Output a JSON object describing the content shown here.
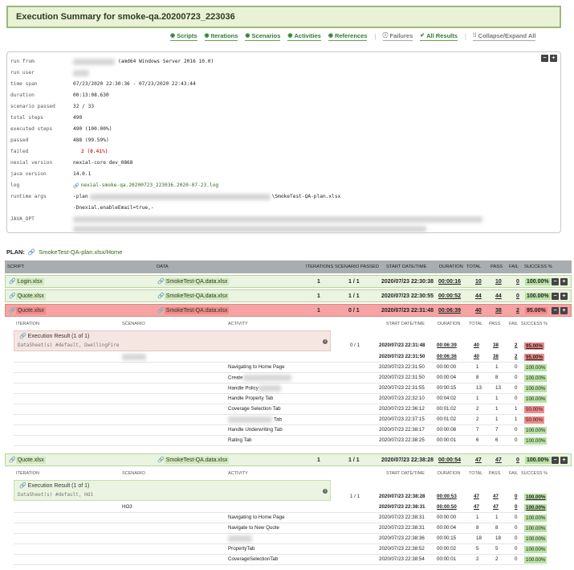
{
  "title": "Execution Summary for smoke-qa.20200723_223036",
  "nav": [
    {
      "label": "Scripts",
      "icon": "circle-check-icon"
    },
    {
      "label": "Iterations",
      "icon": "circle-check-icon"
    },
    {
      "label": "Scenarios",
      "icon": "circle-check-icon"
    },
    {
      "label": "Activities",
      "icon": "circle-check-icon"
    },
    {
      "label": "References",
      "icon": "circle-check-icon"
    },
    {
      "label": "Failures",
      "icon": "info-icon"
    },
    {
      "label": "All Results",
      "icon": "check-icon"
    },
    {
      "label": "Collapse/Expand All",
      "icon": "expand-icon"
    }
  ],
  "summary": [
    {
      "k": "run from",
      "v": "(amd64 Windows Server 2016 10.0)"
    },
    {
      "k": "run user",
      "v": ""
    },
    {
      "k": "time span",
      "v": "07/23/2020 22:30:36 - 07/23/2020 22:43:44"
    },
    {
      "k": "duration",
      "v": "00:13:08.630"
    },
    {
      "k": "scenario passed",
      "v": "32 / 33"
    },
    {
      "k": "total steps",
      "v": "490"
    },
    {
      "k": "executed steps",
      "v": "490 (100.00%)"
    },
    {
      "k": "passed",
      "v": "488 (99.59%)"
    },
    {
      "k": "failed",
      "v": "2 (0.41%)"
    },
    {
      "k": "nexial version",
      "v": "nexial-core dev_0868"
    },
    {
      "k": "java version",
      "v": "14.0.1"
    },
    {
      "k": "log",
      "v": "nexial-smoke-qa.20200723_223036.2020-07-23.log"
    },
    {
      "k": "runtime args",
      "v": "-plan",
      "v2": "\\SmokeTest-QA-plan.xlsx"
    },
    {
      "k": "JAVA_OPT",
      "v": "-Dnexial.enableEmail=true,-"
    }
  ],
  "plan_label": "PLAN:",
  "plan_link": "SmokeTest-QA-plan.xlsx/Home",
  "headers": {
    "script": "SCRIPT",
    "data": "DATA",
    "iterations": "ITERATIONS",
    "scenario_passed": "SCENARIO PASSED",
    "start": "START DATE/TIME",
    "duration": "DURATION",
    "total": "TOTAL",
    "pass": "PASS",
    "fail": "FAIL",
    "success": "SUCCESS %"
  },
  "scripts": [
    {
      "script": "Login.xlsx",
      "data": "SmokeTest-QA.data.xlsx",
      "iterations": "1",
      "scenario_passed": "1 / 1",
      "start": "2020/07/23 22:30:38",
      "duration": "00:00:16",
      "total": "10",
      "pass": "10",
      "fail": "0",
      "success": "100.00%"
    },
    {
      "script": "Quote.xlsx",
      "data": "SmokeTest-QA.data.xlsx",
      "iterations": "1",
      "scenario_passed": "1 / 1",
      "start": "2020/07/23 22:30:55",
      "duration": "00:00:52",
      "total": "44",
      "pass": "44",
      "fail": "0",
      "success": "100.00%"
    },
    {
      "script": "Quote.xlsx",
      "data": "SmokeTest-QA.data.xlsx",
      "iterations": "1",
      "scenario_passed": "0 / 1",
      "start": "2020/07/23 22:31:48",
      "duration": "00:06:39",
      "total": "40",
      "pass": "38",
      "fail": "2",
      "success": "95.00%"
    },
    {
      "script": "Quote.xlsx",
      "data": "SmokeTest-QA.data.xlsx",
      "iterations": "1",
      "scenario_passed": "1 / 1",
      "start": "2020/07/23 22:38:28",
      "duration": "00:00:54",
      "total": "47",
      "pass": "47",
      "fail": "0",
      "success": "100.00%"
    }
  ],
  "sub_headers": {
    "iteration": "ITERATION",
    "scenario": "SCENARIO",
    "activity": "ACTIVITY",
    "start": "START DATE/TIME",
    "duration": "DURATION",
    "total": "TOTAL",
    "pass": "PASS",
    "fail": "FAIL",
    "success": "SUCCESS %"
  },
  "iter1": {
    "title": "Execution Result (1 of 1)",
    "sheet": "DataSheet(s) #default, DwellingFire",
    "scenario_passed": "0 / 1",
    "row": {
      "start": "2020/07/23 22:31:48",
      "duration": "00:06:39",
      "total": "40",
      "pass": "38",
      "fail": "2",
      "success": "95.00%"
    },
    "scenario": {
      "name": "",
      "start": "2020/07/23 22:31:50",
      "duration": "00:06:36",
      "total": "40",
      "pass": "38",
      "fail": "2",
      "success": "95.00%"
    },
    "activities": [
      {
        "name": "Navigating to Home Page",
        "start": "2020/07/23 22:31:50",
        "duration": "00:00:00",
        "total": "1",
        "pass": "1",
        "fail": "0",
        "success": "100.00%"
      },
      {
        "name": "Create",
        "start": "2020/07/23 22:31:50",
        "duration": "00:00:04",
        "total": "8",
        "pass": "8",
        "fail": "0",
        "success": "100.00%"
      },
      {
        "name": "Handle Policy",
        "start": "2020/07/23 22:31:55",
        "duration": "00:00:15",
        "total": "13",
        "pass": "13",
        "fail": "0",
        "success": "100.00%"
      },
      {
        "name": "Handle Property Tab",
        "start": "2020/07/23 22:32:10",
        "duration": "00:04:02",
        "total": "1",
        "pass": "1",
        "fail": "0",
        "success": "100.00%"
      },
      {
        "name": "Coverage Selection Tab",
        "start": "2020/07/23 22:36:12",
        "duration": "00:01:02",
        "total": "2",
        "pass": "1",
        "fail": "1",
        "success": "50.00%"
      },
      {
        "name": "Tab",
        "start": "2020/07/23 22:37:15",
        "duration": "00:01:02",
        "total": "2",
        "pass": "1",
        "fail": "1",
        "success": "50.00%"
      },
      {
        "name": "Handle Underwriting Tab",
        "start": "2020/07/23 22:38:17",
        "duration": "00:00:08",
        "total": "7",
        "pass": "7",
        "fail": "0",
        "success": "100.00%"
      },
      {
        "name": "Rating Tab",
        "start": "2020/07/23 22:38:25",
        "duration": "00:00:01",
        "total": "6",
        "pass": "6",
        "fail": "0",
        "success": "100.00%"
      }
    ]
  },
  "iter2": {
    "title": "Execution Result (1 of 1)",
    "sheet": "DataSheet(s) #default, HO3",
    "scenario_passed": "1 / 1",
    "row": {
      "start": "2020/07/23 22:38:28",
      "duration": "00:00:53",
      "total": "47",
      "pass": "47",
      "fail": "0",
      "success": "100.00%"
    },
    "scenario": {
      "name": "HO3",
      "start": "2020/07/23 22:38:31",
      "duration": "00:00:50",
      "total": "47",
      "pass": "47",
      "fail": "0",
      "success": "100.00%"
    },
    "activities": [
      {
        "name": "Navigating to Home Page",
        "start": "2020/07/23 22:38:31",
        "duration": "00:00:00",
        "total": "1",
        "pass": "1",
        "fail": "0",
        "success": "100.00%"
      },
      {
        "name": "Navigate to New Quote",
        "start": "2020/07/23 22:38:31",
        "duration": "00:00:04",
        "total": "8",
        "pass": "8",
        "fail": "0",
        "success": "100.00%"
      },
      {
        "name": "",
        "start": "2020/07/23 22:38:36",
        "duration": "00:00:15",
        "total": "18",
        "pass": "18",
        "fail": "0",
        "success": "100.00%"
      },
      {
        "name": "PropertyTab",
        "start": "2020/07/23 22:38:52",
        "duration": "00:00:02",
        "total": "5",
        "pass": "5",
        "fail": "0",
        "success": "100.00%"
      },
      {
        "name": "CoverageSelectionTab",
        "start": "2020/07/23 22:38:54",
        "duration": "00:00:01",
        "total": "2",
        "pass": "2",
        "fail": "0",
        "success": "100.00%"
      },
      {
        "name": "AdditionalCoveragesTab",
        "start": "2020/07/23 22:38:56",
        "duration": "00:00:01",
        "total": "3",
        "pass": "3",
        "fail": "0",
        "success": "100.00%"
      }
    ]
  },
  "colors": {
    "green": "#2e7d32",
    "red_row": "#f5a3a3",
    "green_row": "#eaf4e0",
    "header": "#a9adaf"
  }
}
